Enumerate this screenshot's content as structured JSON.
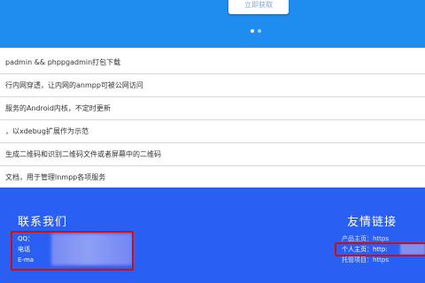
{
  "hero": {
    "button_label": "立即获取",
    "slides": [
      {
        "active": true
      },
      {
        "active": false
      }
    ]
  },
  "list": {
    "items": [
      "padmin && phppgadmin打包下载",
      "行内网穿透，让内网的anmpp可被公网访问",
      "服务的Android内核，不定时更新",
      "，以xdebug扩展作为示范",
      "生成二维码和识别二维码文件或者屏幕中的二维码",
      "文档，用于管理lnmpp各项服务"
    ]
  },
  "footer": {
    "contact_title": "联系我们",
    "contact_lines": [
      "QQ：",
      "电话",
      "E-ma"
    ],
    "links_title": "友情链接",
    "links": [
      "产品主页：https",
      "个人主页：http:",
      "托管项目：https"
    ],
    "highlight_color": "#c8101a"
  }
}
